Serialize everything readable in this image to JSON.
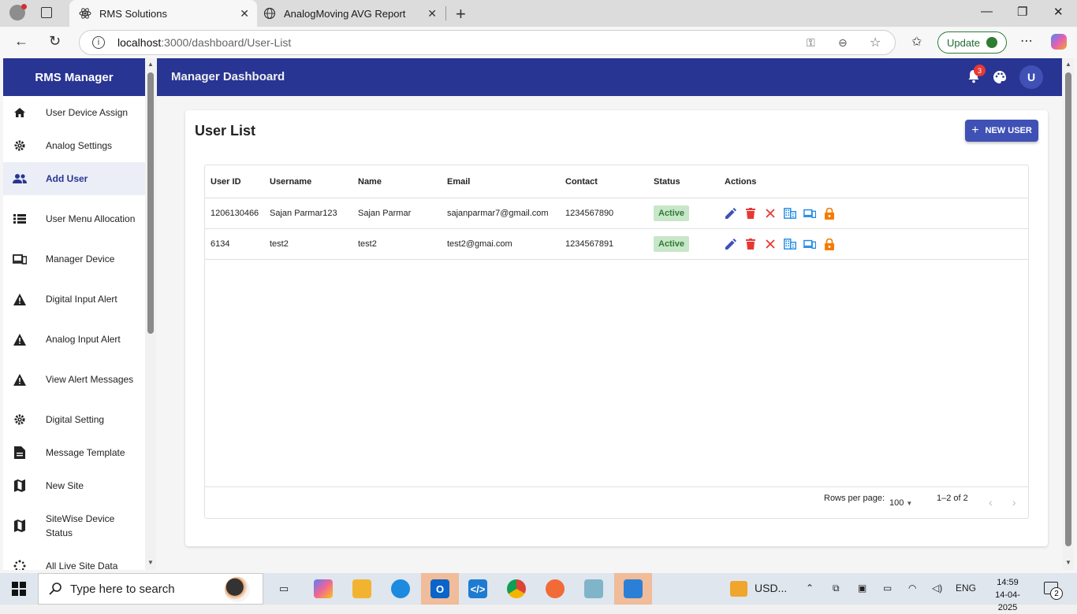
{
  "browser": {
    "tabs": [
      {
        "label": "RMS Solutions",
        "active": true
      },
      {
        "label": "AnalogMoving AVG Report",
        "active": false
      }
    ],
    "url_host": "localhost",
    "url_path": ":3000/dashboard/User-List",
    "update_label": "Update"
  },
  "sidebar": {
    "title": "RMS Manager",
    "items": [
      {
        "label": "User Device Assign",
        "icon": "home-icon"
      },
      {
        "label": "Analog Settings",
        "icon": "gear-icon"
      },
      {
        "label": "Add User",
        "icon": "people-icon",
        "active": true
      },
      {
        "label": "User Menu Allocation",
        "icon": "list-icon"
      },
      {
        "label": "Manager Device",
        "icon": "devices-icon"
      },
      {
        "label": "Digital Input Alert",
        "icon": "warning-icon"
      },
      {
        "label": "Analog Input Alert",
        "icon": "warning-icon"
      },
      {
        "label": "View Alert Messages",
        "icon": "warning-icon"
      },
      {
        "label": "Digital Setting",
        "icon": "gear-icon"
      },
      {
        "label": "Message Template",
        "icon": "document-icon"
      },
      {
        "label": "New Site",
        "icon": "map-icon"
      },
      {
        "label": "SiteWise Device Status",
        "icon": "map-icon"
      },
      {
        "label": "All Live Site Data",
        "icon": "live-icon"
      }
    ]
  },
  "header": {
    "title": "Manager Dashboard",
    "notification_count": "3",
    "avatar_letter": "U"
  },
  "page": {
    "title": "User List",
    "new_user_label": "NEW USER"
  },
  "table": {
    "columns": [
      "User ID",
      "Username",
      "Name",
      "Email",
      "Contact",
      "Status",
      "Actions"
    ],
    "rows": [
      {
        "user_id": "1206130466",
        "username": "Sajan Parmar123",
        "name": "Sajan Parmar",
        "email": "sajanparmar7@gmail.com",
        "contact": "1234567890",
        "status": "Active"
      },
      {
        "user_id": "6134",
        "username": "test2",
        "name": "test2",
        "email": "test2@gmai.com",
        "contact": "1234567891",
        "status": "Active"
      }
    ],
    "footer": {
      "rows_per_page_label": "Rows per page:",
      "rows_per_page_value": "100",
      "count_label": "1–2 of 2"
    }
  },
  "taskbar": {
    "search_placeholder": "Type here to search",
    "tray_currency": "USD...",
    "language": "ENG",
    "time": "14:59",
    "date": "14-04-2025",
    "notification_count": "2"
  },
  "colors": {
    "primary": "#283593",
    "accent": "#3f51b5",
    "status_active_bg": "#c8e6c9",
    "status_active_text": "#2e7d32",
    "edit": "#3f51b5",
    "delete": "#e53935",
    "site": "#1e88e5",
    "lock": "#f57c00"
  }
}
